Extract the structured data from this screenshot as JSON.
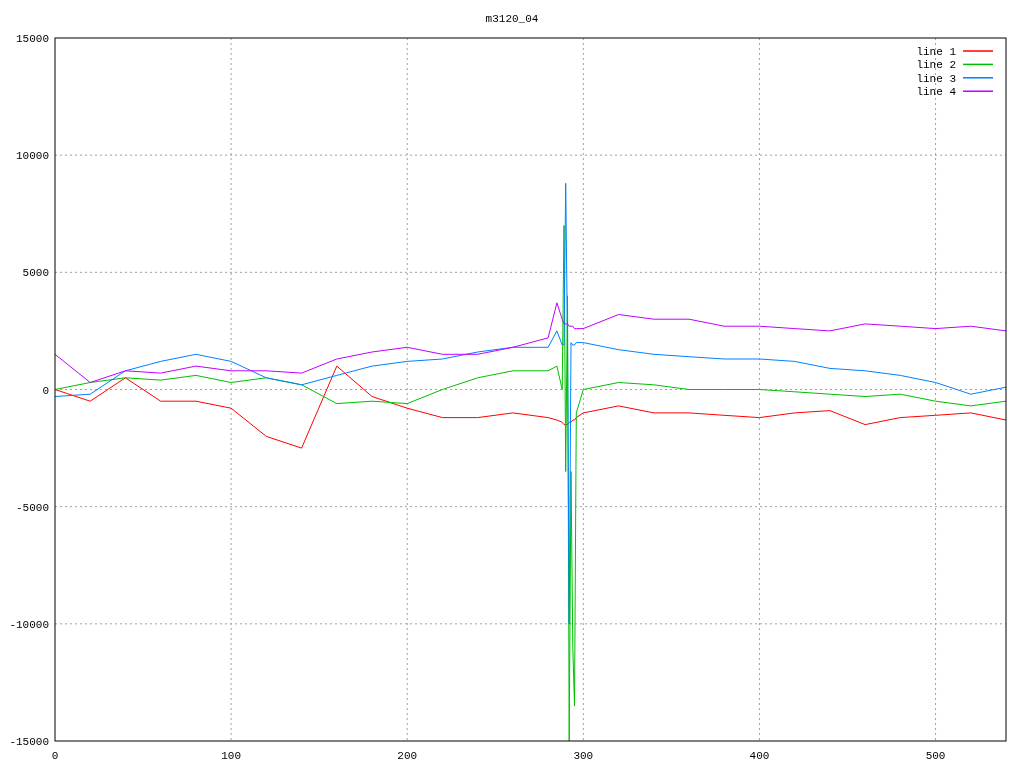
{
  "chart_data": {
    "type": "line",
    "title": "m3120_04",
    "x": [
      0,
      20,
      40,
      60,
      80,
      100,
      120,
      140,
      160,
      180,
      200,
      220,
      240,
      260,
      280,
      285,
      288,
      289,
      290,
      291,
      292,
      293,
      294,
      295,
      296,
      300,
      320,
      340,
      360,
      380,
      400,
      420,
      440,
      460,
      480,
      500,
      520,
      540
    ],
    "series": [
      {
        "name": "line 1",
        "color": "#ff0000",
        "values": [
          0,
          -500,
          500,
          -500,
          -500,
          -800,
          -2000,
          -2500,
          1000,
          -300,
          -800,
          -1200,
          -1200,
          -1000,
          -1200,
          -1300,
          -1400,
          -1500,
          -1500,
          -1500,
          -1400,
          -1400,
          -1300,
          -1300,
          -1200,
          -1000,
          -700,
          -1000,
          -1000,
          -1100,
          -1200,
          -1000,
          -900,
          -1500,
          -1200,
          -1100,
          -1000,
          -1300
        ]
      },
      {
        "name": "line 2",
        "color": "#00c000",
        "values": [
          0,
          300,
          500,
          400,
          600,
          300,
          500,
          200,
          -600,
          -500,
          -600,
          0,
          500,
          800,
          800,
          1000,
          0,
          7000,
          -3500,
          4000,
          -15000,
          -3500,
          -11000,
          -13500,
          -1000,
          0,
          300,
          200,
          0,
          0,
          0,
          -100,
          -200,
          -300,
          -200,
          -500,
          -700,
          -500
        ]
      },
      {
        "name": "line 3",
        "color": "#0080ff",
        "values": [
          -300,
          -200,
          800,
          1200,
          1500,
          1200,
          500,
          200,
          600,
          1000,
          1200,
          1300,
          1600,
          1800,
          1800,
          2500,
          1900,
          1900,
          8800,
          2000,
          -10000,
          2000,
          1900,
          1900,
          2000,
          2000,
          1700,
          1500,
          1400,
          1300,
          1300,
          1200,
          900,
          800,
          600,
          300,
          -200,
          100
        ]
      },
      {
        "name": "line 4",
        "color": "#c000ff",
        "values": [
          1500,
          300,
          800,
          700,
          1000,
          800,
          800,
          700,
          1300,
          1600,
          1800,
          1500,
          1500,
          1800,
          2200,
          3700,
          3000,
          2800,
          2800,
          2800,
          2700,
          2700,
          2700,
          2600,
          2600,
          2600,
          3200,
          3000,
          3000,
          2700,
          2700,
          2600,
          2500,
          2800,
          2700,
          2600,
          2700,
          2500
        ]
      }
    ],
    "grid": true,
    "legend": true,
    "xlim": [
      0,
      540
    ],
    "ylim": [
      -15000,
      15000
    ],
    "xticks": [
      0,
      100,
      200,
      300,
      400,
      500
    ],
    "yticks": [
      -15000,
      -10000,
      -5000,
      0,
      5000,
      10000,
      15000
    ]
  }
}
